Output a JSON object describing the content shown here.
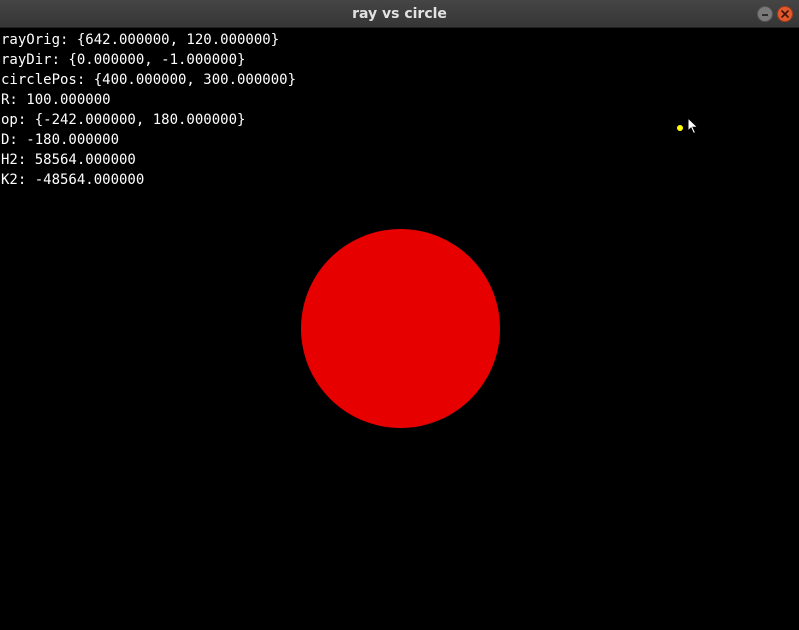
{
  "window": {
    "title": "ray vs circle"
  },
  "debug": {
    "lines": [
      "rayOrig: {642.000000, 120.000000}",
      "rayDir: {0.000000, -1.000000}",
      "circlePos: {400.000000, 300.000000}",
      "R: 100.000000",
      "op: {-242.000000, 180.000000}",
      "D: -180.000000",
      "H2: 58564.000000",
      "K2: -48564.000000"
    ]
  },
  "colors": {
    "background": "#000000",
    "text": "#ffffff",
    "circle": "#e60000",
    "ray_origin": "#ffff00",
    "close_button": "#e25a2c"
  },
  "icons": {
    "minimize": "minimize-icon",
    "close": "close-icon",
    "cursor": "mouse-cursor-icon"
  }
}
